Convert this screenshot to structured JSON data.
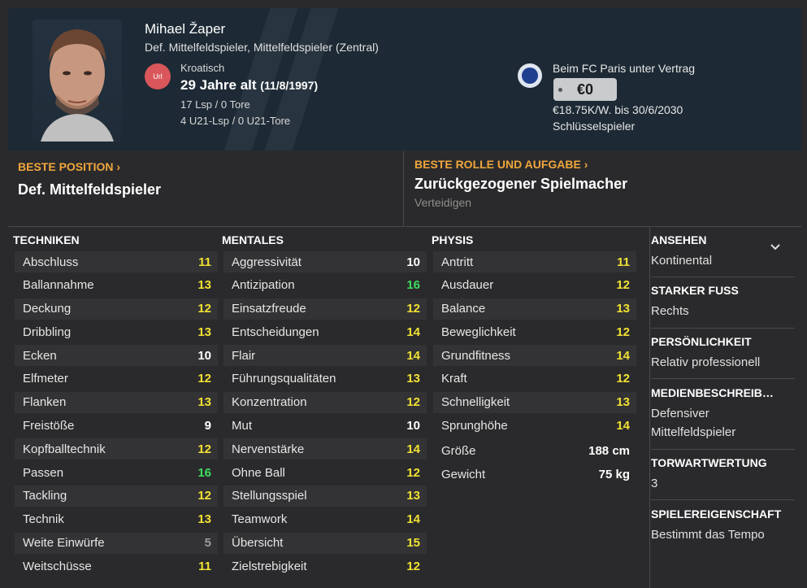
{
  "header": {
    "name": "Mihael Žaper",
    "positions": "Def. Mittelfeldspieler, Mittelfeldspieler (Zentral)",
    "nat_badge": "Url",
    "nationality": "Kroatisch",
    "age": "29 Jahre alt",
    "dob": "(11/8/1997)",
    "caps": "17 Lsp / 0 Tore",
    "u21_caps": "4 U21-Lsp / 0 U21-Tore",
    "contract_label": "Beim FC Paris unter Vertrag",
    "value": "€0",
    "wage": "€18.75K/W. bis 30/6/2030",
    "squad_status": "Schlüsselspieler"
  },
  "best_position": {
    "label": "BESTE POSITION ›",
    "value": "Def. Mittelfeldspieler"
  },
  "best_role": {
    "label": "BESTE ROLLE UND AUFGABE ›",
    "value": "Zurückgezogener Spielmacher",
    "duty": "Verteidigen"
  },
  "technical": {
    "title": "TECHNIKEN",
    "rows": [
      {
        "name": "Abschluss",
        "value": "11"
      },
      {
        "name": "Ballannahme",
        "value": "13"
      },
      {
        "name": "Deckung",
        "value": "12"
      },
      {
        "name": "Dribbling",
        "value": "13"
      },
      {
        "name": "Ecken",
        "value": "10"
      },
      {
        "name": "Elfmeter",
        "value": "12"
      },
      {
        "name": "Flanken",
        "value": "13"
      },
      {
        "name": "Freistöße",
        "value": "9"
      },
      {
        "name": "Kopfballtechnik",
        "value": "12"
      },
      {
        "name": "Passen",
        "value": "16"
      },
      {
        "name": "Tackling",
        "value": "12"
      },
      {
        "name": "Technik",
        "value": "13"
      },
      {
        "name": "Weite Einwürfe",
        "value": "5"
      },
      {
        "name": "Weitschüsse",
        "value": "11"
      }
    ]
  },
  "mental": {
    "title": "MENTALES",
    "rows": [
      {
        "name": "Aggressivität",
        "value": "10"
      },
      {
        "name": "Antizipation",
        "value": "16"
      },
      {
        "name": "Einsatzfreude",
        "value": "12"
      },
      {
        "name": "Entscheidungen",
        "value": "14"
      },
      {
        "name": "Flair",
        "value": "14"
      },
      {
        "name": "Führungsqualitäten",
        "value": "13"
      },
      {
        "name": "Konzentration",
        "value": "12"
      },
      {
        "name": "Mut",
        "value": "10"
      },
      {
        "name": "Nervenstärke",
        "value": "14"
      },
      {
        "name": "Ohne Ball",
        "value": "12"
      },
      {
        "name": "Stellungsspiel",
        "value": "13"
      },
      {
        "name": "Teamwork",
        "value": "14"
      },
      {
        "name": "Übersicht",
        "value": "15"
      },
      {
        "name": "Zielstrebigkeit",
        "value": "12"
      }
    ]
  },
  "physical": {
    "title": "PHYSIS",
    "rows": [
      {
        "name": "Antritt",
        "value": "11"
      },
      {
        "name": "Ausdauer",
        "value": "12"
      },
      {
        "name": "Balance",
        "value": "13"
      },
      {
        "name": "Beweglichkeit",
        "value": "12"
      },
      {
        "name": "Grundfitness",
        "value": "14"
      },
      {
        "name": "Kraft",
        "value": "12"
      },
      {
        "name": "Schnelligkeit",
        "value": "13"
      },
      {
        "name": "Sprunghöhe",
        "value": "14"
      }
    ],
    "extra": [
      {
        "name": "Größe",
        "value": "188 cm"
      },
      {
        "name": "Gewicht",
        "value": "75 kg"
      }
    ]
  },
  "side": [
    {
      "title": "ANSEHEN",
      "value": "Kontinental"
    },
    {
      "title": "STARKER FUSS",
      "value": "Rechts"
    },
    {
      "title": "PERSÖNLICHKEIT",
      "value": "Relativ professionell"
    },
    {
      "title": "MEDIENBESCHREIB…",
      "value": "Defensiver Mittelfeldspieler"
    },
    {
      "title": "TORWARTWERTUNG",
      "value": "3"
    },
    {
      "title": "SPIELEREIGENSCHAFT",
      "value": "Bestimmt das Tempo"
    }
  ],
  "colors": {
    "grey": "#9a9a9a",
    "white": "#ffffff",
    "yellow": "#f2e233",
    "green": "#3fdd5f",
    "accent": "#f0a63c",
    "header_bg": "#1d2a35"
  }
}
